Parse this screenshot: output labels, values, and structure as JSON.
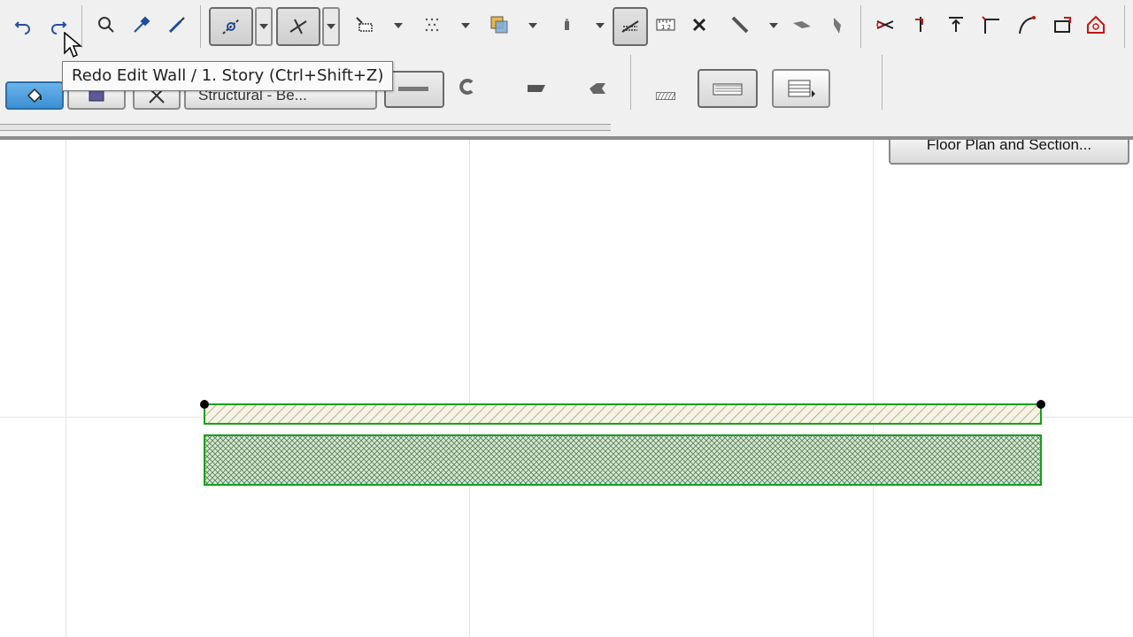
{
  "toolbar": {
    "icons": [
      "undo-icon",
      "redo-icon",
      "find-select-icon",
      "eyedropper-icon",
      "syringe-icon",
      "suspend-groups-icon",
      "trim-icon",
      "element-info-icon",
      "pattern-icon",
      "layer-stack-icon",
      "pencil-icon",
      "wall-icon",
      "dimension-icon",
      "delete-icon",
      "magic-wand-icon",
      "slab-icon",
      "profile-icon",
      "split-icon",
      "hook-icon",
      "elevate-icon",
      "corner-icon",
      "curve-icon",
      "offset-icon",
      "home-icon"
    ]
  },
  "tooltip": {
    "text": "Redo Edit Wall / 1. Story (Ctrl+Shift+Z)"
  },
  "info_box": {
    "structural_label": "Structural - Be...",
    "floor_plan_button": "Floor Plan and Section..."
  },
  "canvas": {
    "colors": {
      "wall_fill": "#d6e9d0",
      "wall_stroke": "#16a016",
      "hatch_top": "#b59c6e",
      "hatch_bottom": "#5b7d5b",
      "grid": "#e4e4e4"
    }
  }
}
